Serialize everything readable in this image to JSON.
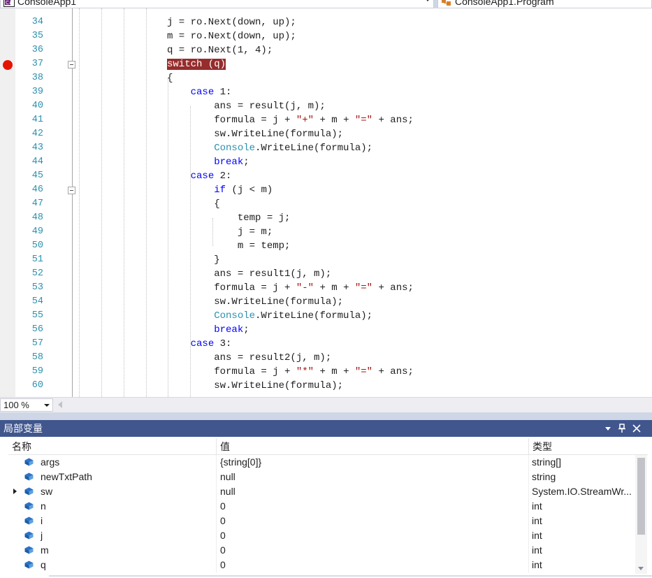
{
  "nav": {
    "project": "ConsoleApp1",
    "member": "ConsoleApp1.Program"
  },
  "editor": {
    "first_line": 33,
    "lines": [
      {
        "num": "",
        "tokens": [
          {
            "t": "        ",
            "c": ""
          }
        ]
      },
      {
        "num": "34",
        "tokens": [
          {
            "t": "j = ro.Next(down, up);",
            "c": ""
          }
        ]
      },
      {
        "num": "35",
        "tokens": [
          {
            "t": "m = ro.Next(down, up);",
            "c": ""
          }
        ]
      },
      {
        "num": "36",
        "tokens": [
          {
            "t": "q = ro.Next(1, 4);",
            "c": ""
          }
        ]
      },
      {
        "num": "37",
        "tokens": [
          {
            "t": "switch (q)",
            "c": "bphl"
          }
        ]
      },
      {
        "num": "38",
        "tokens": [
          {
            "t": "{",
            "c": ""
          }
        ]
      },
      {
        "num": "39",
        "tokens": [
          {
            "t": "    ",
            "c": ""
          },
          {
            "t": "case",
            "c": "kw"
          },
          {
            "t": " 1:",
            "c": ""
          }
        ]
      },
      {
        "num": "40",
        "tokens": [
          {
            "t": "        ans = result(j, m);",
            "c": ""
          }
        ]
      },
      {
        "num": "41",
        "tokens": [
          {
            "t": "        formula = j + ",
            "c": ""
          },
          {
            "t": "\"+\"",
            "c": "st"
          },
          {
            "t": " + m + ",
            "c": ""
          },
          {
            "t": "\"=\"",
            "c": "st"
          },
          {
            "t": " + ans;",
            "c": ""
          }
        ]
      },
      {
        "num": "42",
        "tokens": [
          {
            "t": "        sw.WriteLine(formula);",
            "c": ""
          }
        ]
      },
      {
        "num": "43",
        "tokens": [
          {
            "t": "        ",
            "c": ""
          },
          {
            "t": "Console",
            "c": "ty"
          },
          {
            "t": ".WriteLine(formula);",
            "c": ""
          }
        ]
      },
      {
        "num": "44",
        "tokens": [
          {
            "t": "        ",
            "c": ""
          },
          {
            "t": "break",
            "c": "kw"
          },
          {
            "t": ";",
            "c": ""
          }
        ]
      },
      {
        "num": "45",
        "tokens": [
          {
            "t": "    ",
            "c": ""
          },
          {
            "t": "case",
            "c": "kw"
          },
          {
            "t": " 2:",
            "c": ""
          }
        ]
      },
      {
        "num": "46",
        "tokens": [
          {
            "t": "        ",
            "c": ""
          },
          {
            "t": "if",
            "c": "kw"
          },
          {
            "t": " (j < m)",
            "c": ""
          }
        ]
      },
      {
        "num": "47",
        "tokens": [
          {
            "t": "        {",
            "c": ""
          }
        ]
      },
      {
        "num": "48",
        "tokens": [
          {
            "t": "            temp = j;",
            "c": ""
          }
        ]
      },
      {
        "num": "49",
        "tokens": [
          {
            "t": "            j = m;",
            "c": ""
          }
        ]
      },
      {
        "num": "50",
        "tokens": [
          {
            "t": "            m = temp;",
            "c": ""
          }
        ]
      },
      {
        "num": "51",
        "tokens": [
          {
            "t": "        }",
            "c": ""
          }
        ]
      },
      {
        "num": "52",
        "tokens": [
          {
            "t": "        ans = result1(j, m);",
            "c": ""
          }
        ]
      },
      {
        "num": "53",
        "tokens": [
          {
            "t": "        formula = j + ",
            "c": ""
          },
          {
            "t": "\"-\"",
            "c": "st"
          },
          {
            "t": " + m + ",
            "c": ""
          },
          {
            "t": "\"=\"",
            "c": "st"
          },
          {
            "t": " + ans;",
            "c": ""
          }
        ]
      },
      {
        "num": "54",
        "tokens": [
          {
            "t": "        sw.WriteLine(formula);",
            "c": ""
          }
        ]
      },
      {
        "num": "55",
        "tokens": [
          {
            "t": "        ",
            "c": ""
          },
          {
            "t": "Console",
            "c": "ty"
          },
          {
            "t": ".WriteLine(formula);",
            "c": ""
          }
        ]
      },
      {
        "num": "56",
        "tokens": [
          {
            "t": "        ",
            "c": ""
          },
          {
            "t": "break",
            "c": "kw"
          },
          {
            "t": ";",
            "c": ""
          }
        ]
      },
      {
        "num": "57",
        "tokens": [
          {
            "t": "    ",
            "c": ""
          },
          {
            "t": "case",
            "c": "kw"
          },
          {
            "t": " 3:",
            "c": ""
          }
        ]
      },
      {
        "num": "58",
        "tokens": [
          {
            "t": "        ans = result2(j, m);",
            "c": ""
          }
        ]
      },
      {
        "num": "59",
        "tokens": [
          {
            "t": "        formula = j + ",
            "c": ""
          },
          {
            "t": "\"*\"",
            "c": "st"
          },
          {
            "t": " + m + ",
            "c": ""
          },
          {
            "t": "\"=\"",
            "c": "st"
          },
          {
            "t": " + ans;",
            "c": ""
          }
        ]
      },
      {
        "num": "60",
        "tokens": [
          {
            "t": "        sw.WriteLine(formula);",
            "c": ""
          }
        ]
      }
    ],
    "breakpoint_line": "37"
  },
  "status": {
    "zoom": "100 %"
  },
  "locals": {
    "title": "局部变量",
    "columns": {
      "name": "名称",
      "value": "值",
      "type": "类型"
    },
    "rows": [
      {
        "name": "args",
        "value": "{string[0]}",
        "type": "string[]",
        "expandable": false
      },
      {
        "name": "newTxtPath",
        "value": "null",
        "type": "string",
        "expandable": false
      },
      {
        "name": "sw",
        "value": "null",
        "type": "System.IO.StreamWr...",
        "expandable": true
      },
      {
        "name": "n",
        "value": "0",
        "type": "int",
        "expandable": false
      },
      {
        "name": "i",
        "value": "0",
        "type": "int",
        "expandable": false
      },
      {
        "name": "j",
        "value": "0",
        "type": "int",
        "expandable": false
      },
      {
        "name": "m",
        "value": "0",
        "type": "int",
        "expandable": false
      },
      {
        "name": "q",
        "value": "0",
        "type": "int",
        "expandable": false
      }
    ]
  },
  "colors": {
    "keyword": "#0000ff",
    "type": "#2b91af",
    "string": "#a31515",
    "line_number": "#2b91af",
    "breakpoint": "#e51400",
    "breakpoint_highlight": "#962c2c",
    "toolwindow_header": "#40568d"
  },
  "icons": {
    "project": "csharp-project-icon",
    "member": "class-member-icon",
    "local": "local-variable-icon",
    "pin": "pin-icon",
    "close": "close-icon",
    "dropdown": "chevron-down-icon"
  }
}
